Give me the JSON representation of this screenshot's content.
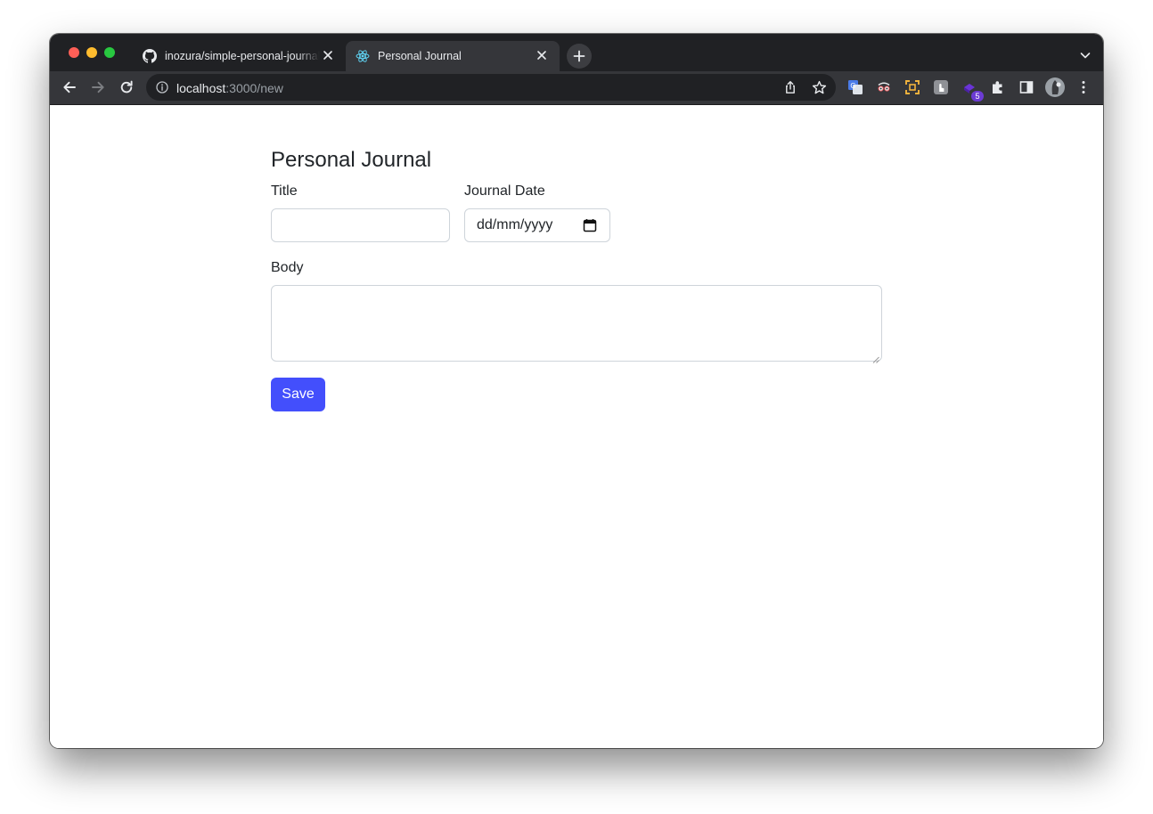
{
  "browser": {
    "tabs": [
      {
        "title": "inozura/simple-personal-journal",
        "favicon": "github-icon",
        "active": false
      },
      {
        "title": "Personal Journal",
        "favicon": "react-icon",
        "active": true
      }
    ],
    "address_bar": {
      "host": "localhost",
      "path": ":3000/new"
    },
    "extensions_badge": "5"
  },
  "page": {
    "title": "Personal Journal",
    "form": {
      "title_label": "Title",
      "title_value": "",
      "date_label": "Journal Date",
      "date_placeholder": "dd/mm/yyyy",
      "body_label": "Body",
      "body_value": "",
      "save_label": "Save"
    }
  },
  "colors": {
    "primary_button": "#434ffc",
    "tab_strip": "#202124",
    "toolbar": "#35363a"
  }
}
